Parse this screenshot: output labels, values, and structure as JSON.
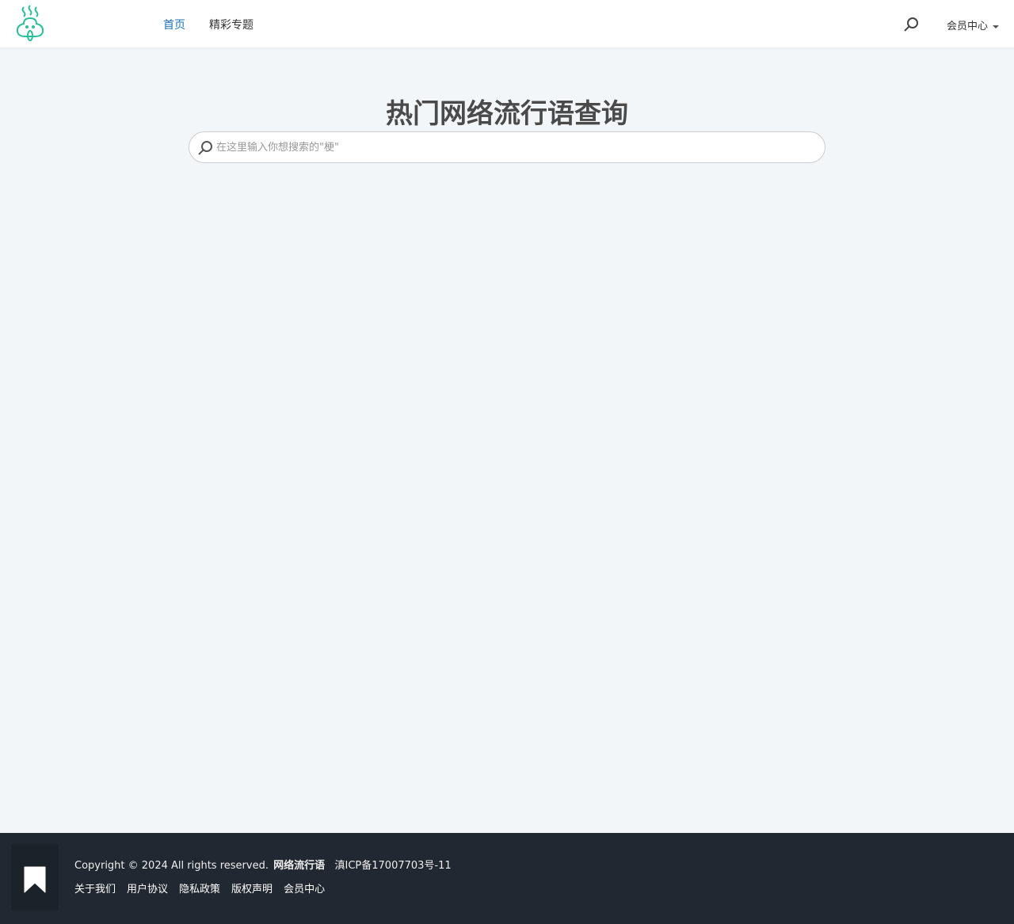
{
  "header": {
    "nav": [
      "首页",
      "精彩专题"
    ],
    "member_label": "会员中心"
  },
  "main": {
    "title": "热门网络流行语查询",
    "search_placeholder": "在这里输入你想搜索的\"梗\""
  },
  "footer": {
    "copyright": "Copyright © 2024 All rights reserved.",
    "site_name": "网络流行语",
    "icp": "滇ICP备17007703号-11",
    "links": [
      "关于我们",
      "用户协议",
      "隐私政策",
      "版权声明",
      "会员中心"
    ]
  },
  "colors": {
    "accent": "#1e73be",
    "logo": "#2bbf9b",
    "footer_bg": "#212831"
  }
}
